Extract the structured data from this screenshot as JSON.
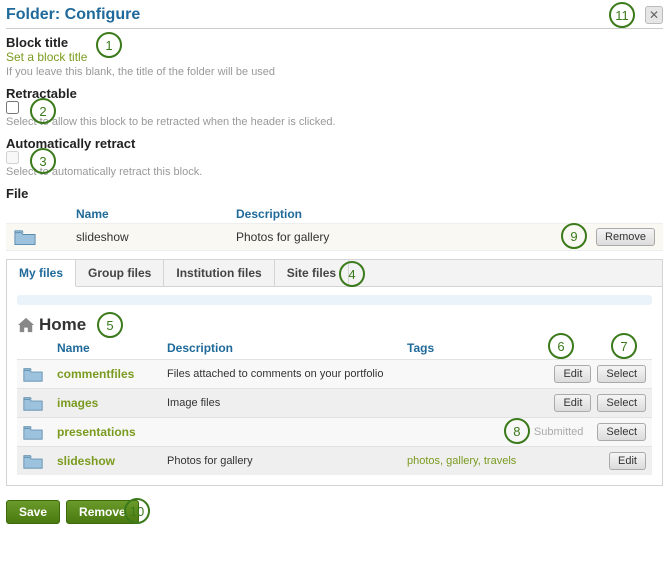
{
  "header": {
    "title": "Folder: Configure"
  },
  "block_title": {
    "label": "Block title",
    "link": "Set a block title",
    "hint": "If you leave this blank, the title of the folder will be used"
  },
  "retractable": {
    "label": "Retractable",
    "hint": "Select to allow this block to be retracted when the header is clicked."
  },
  "auto_retract": {
    "label": "Automatically retract",
    "hint": "Select to automatically retract this block."
  },
  "file": {
    "label": "File",
    "col_name": "Name",
    "col_desc": "Description",
    "row_name": "slideshow",
    "row_desc": "Photos for gallery",
    "remove_btn": "Remove"
  },
  "tabs": [
    "My files",
    "Group files",
    "Institution files",
    "Site files"
  ],
  "browser": {
    "home": "Home",
    "cols": {
      "name": "Name",
      "desc": "Description",
      "tags": "Tags"
    },
    "rows": [
      {
        "name": "commentfiles",
        "desc": "Files attached to comments on your portfolio",
        "tags": "",
        "edit": true,
        "select": true,
        "submitted": false
      },
      {
        "name": "images",
        "desc": "Image files",
        "tags": "",
        "edit": true,
        "select": true,
        "submitted": false
      },
      {
        "name": "presentations",
        "desc": "",
        "tags": "",
        "edit": false,
        "select": true,
        "submitted": true
      },
      {
        "name": "slideshow",
        "desc": "Photos for gallery",
        "tags_list": [
          "photos",
          "gallery",
          "travels"
        ],
        "edit": true,
        "select": false,
        "submitted": false
      }
    ],
    "edit_label": "Edit",
    "select_label": "Select",
    "submitted_label": "Submitted"
  },
  "footer": {
    "save": "Save",
    "remove": "Remove"
  },
  "callouts": [
    "1",
    "2",
    "3",
    "4",
    "5",
    "6",
    "7",
    "8",
    "9",
    "10",
    "11"
  ]
}
